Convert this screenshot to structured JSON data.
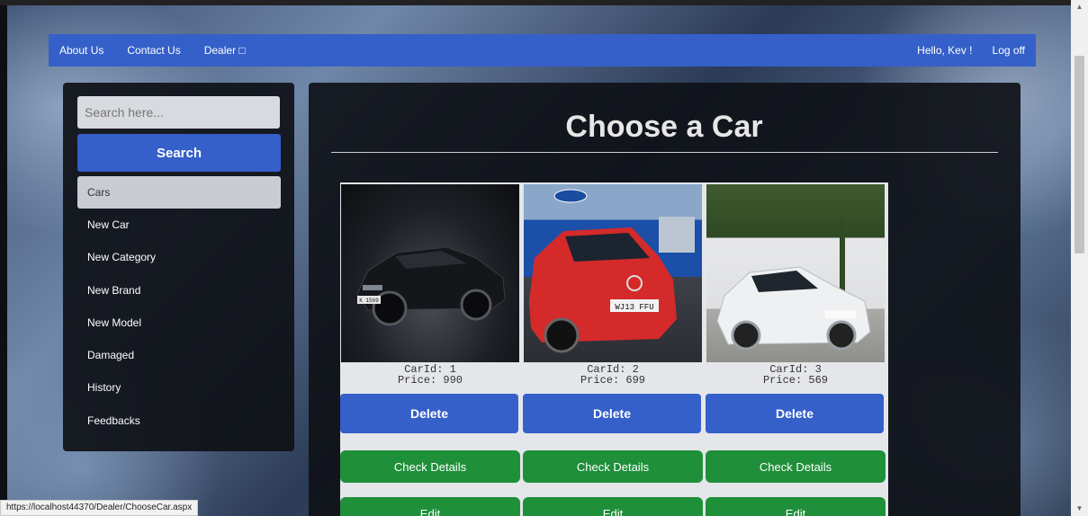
{
  "nav": {
    "about": "About Us",
    "contact": "Contact Us",
    "dealer": "Dealer □",
    "greeting": "Hello, Kev !",
    "logoff": "Log off"
  },
  "sidebar": {
    "search_placeholder": "Search here...",
    "search_label": "Search",
    "items": [
      {
        "label": "Cars",
        "active": true
      },
      {
        "label": "New Car"
      },
      {
        "label": "New Category"
      },
      {
        "label": "New Brand"
      },
      {
        "label": "New Model"
      },
      {
        "label": "Damaged"
      },
      {
        "label": "History"
      },
      {
        "label": "Feedbacks"
      }
    ]
  },
  "main": {
    "title": "Choose a Car",
    "cars": [
      {
        "id_text": "CarId: 1",
        "price_text": "Price: 990",
        "plate": "K 1569",
        "color": "#15161a",
        "delete": "Delete",
        "details": "Check Details",
        "edit": "Edit"
      },
      {
        "id_text": "CarId: 2",
        "price_text": "Price: 699",
        "plate": "WJ13 FFU",
        "color": "#d42a2a",
        "delete": "Delete",
        "details": "Check Details",
        "edit": "Edit"
      },
      {
        "id_text": "CarId: 3",
        "price_text": "Price: 569",
        "plate": "",
        "color": "#e9ecef",
        "delete": "Delete",
        "details": "Check Details",
        "edit": "Edit"
      }
    ]
  },
  "status": {
    "url": "https://localhost44370/Dealer/ChooseCar.aspx"
  },
  "colors": {
    "nav": "#3560c9",
    "primary": "#3560c9",
    "success": "#1f8f3a",
    "panel": "#0f1117"
  }
}
